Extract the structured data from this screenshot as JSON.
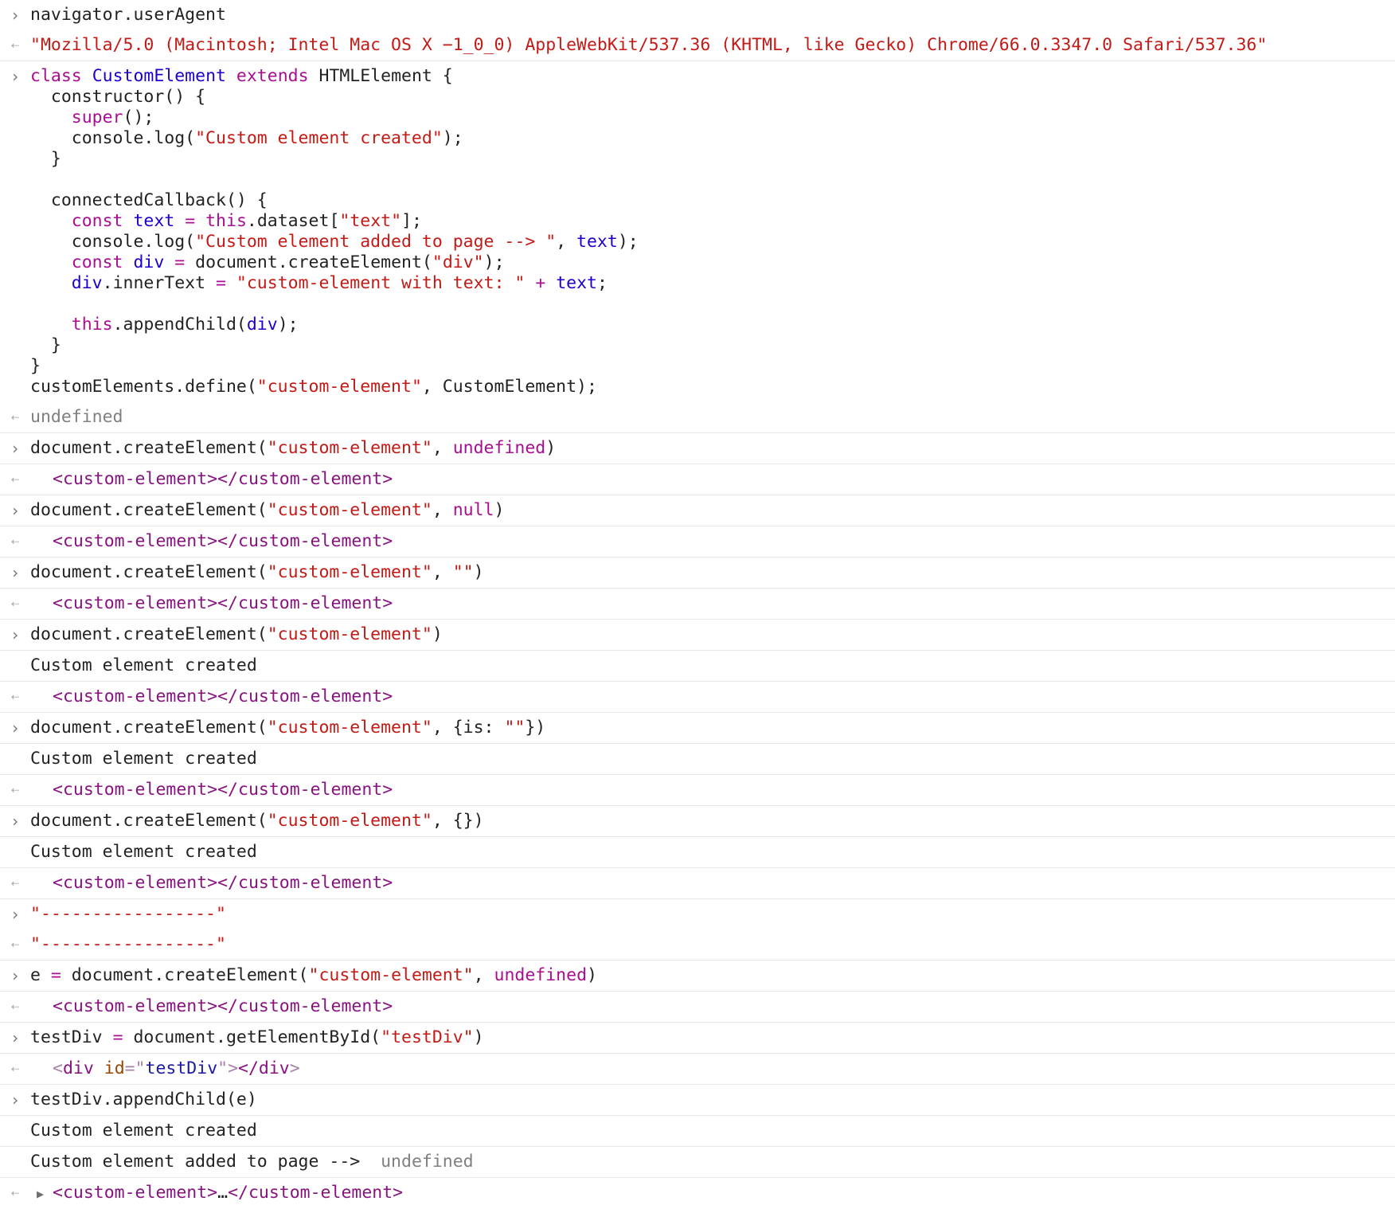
{
  "console": {
    "ua_input": "navigator.userAgent",
    "ua_output": "\"Mozilla/5.0 (Macintosh; Intel Mac OS X −1_0_0) AppleWebKit/537.36 (KHTML, like Gecko) Chrome/66.0.3347.0 Safari/537.36\"",
    "undefined": "undefined",
    "custom_created": "Custom element created",
    "added_msg": "Custom element added to page --> ",
    "dashes": "\"-----------------\"",
    "el_open": "<custom-element>",
    "el_close": "</custom-element>",
    "el_ellipsis": "…"
  },
  "icons": {
    "input_prompt": "›",
    "output_arrow": "⇠",
    "expand_triangle": "▶"
  },
  "colors": {
    "keyword": "#aa0d91",
    "string": "#c41a16",
    "identifier": "#1c00cf",
    "tag": "#881280",
    "muted": "#808080"
  }
}
